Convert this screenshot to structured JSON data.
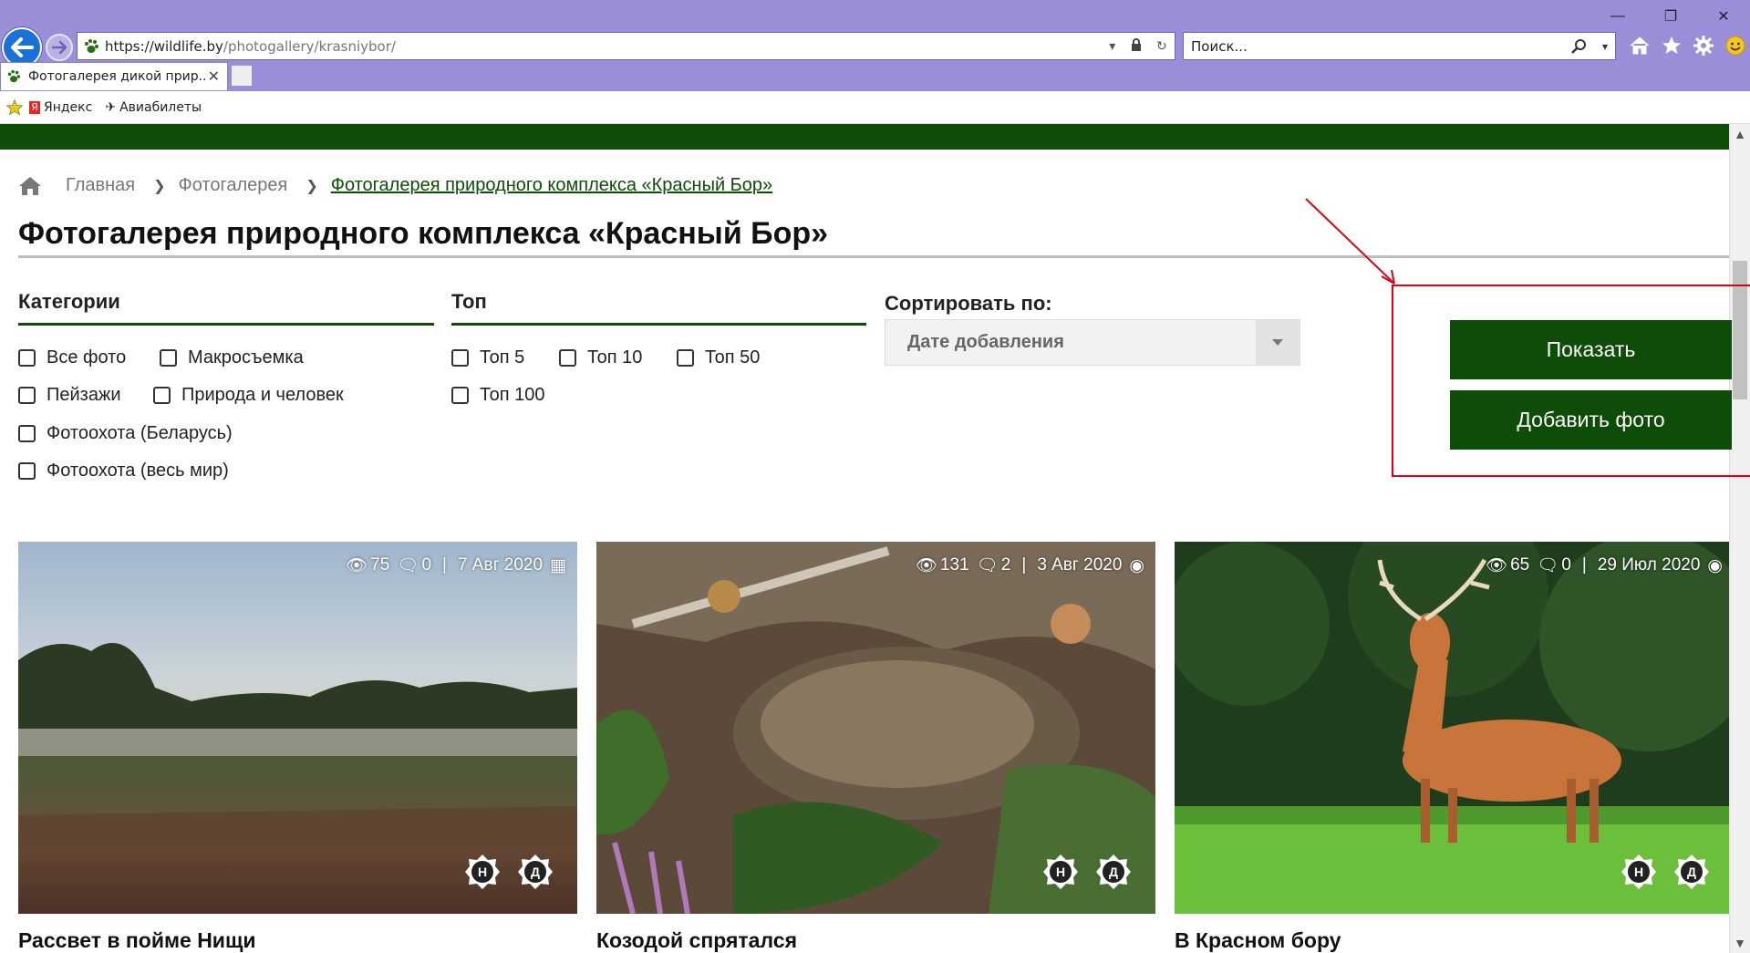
{
  "browser": {
    "url_host": "https://wildlife.by",
    "url_path": "/photogallery/krasniybor/",
    "search_placeholder": "Поиск...",
    "tab_title": "Фотогалерея дикой прир...",
    "favorites": [
      {
        "label": "Яндекс",
        "icon": "yandex-icon"
      },
      {
        "label": "Авиабилеты",
        "icon": "plane-icon"
      }
    ]
  },
  "breadcrumbs": {
    "home": "home-icon",
    "items": [
      "Главная",
      "Фотогалерея",
      "Фотогалерея природного комплекса «Красный Бор»"
    ]
  },
  "page_title": "Фотогалерея природного комплекса «Красный Бор»",
  "filters": {
    "categories": {
      "heading": "Категории",
      "options": [
        "Все фото",
        "Макросъемка",
        "Пейзажи",
        "Природа и человек",
        "Фотоохота (Беларусь)",
        "Фотоохота (весь мир)"
      ]
    },
    "top": {
      "heading": "Топ",
      "options": [
        "Топ 5",
        "Топ 10",
        "Топ 50",
        "Топ 100"
      ]
    },
    "sort": {
      "label": "Сортировать по:",
      "selected": "Дате добавления"
    }
  },
  "actions": {
    "show": "Показать",
    "add_photo": "Добавить фото"
  },
  "cards": [
    {
      "title": "Рассвет в пойме Нищи",
      "views": "75",
      "comments": "0",
      "date": "7 Авг 2020",
      "badge_1": "Н",
      "badge_2": "Д"
    },
    {
      "title": "Козодой спрятался",
      "views": "131",
      "comments": "2",
      "date": "3 Авг 2020",
      "badge_1": "Н",
      "badge_2": "Д"
    },
    {
      "title": "В Красном бору",
      "views": "65",
      "comments": "0",
      "date": "29 Июл 2020",
      "badge_1": "Н",
      "badge_2": "Д"
    }
  ],
  "colors": {
    "brand_green": "#0e4d07",
    "browser_frame": "#9a8ed8",
    "annotation_red": "#e0000f"
  }
}
